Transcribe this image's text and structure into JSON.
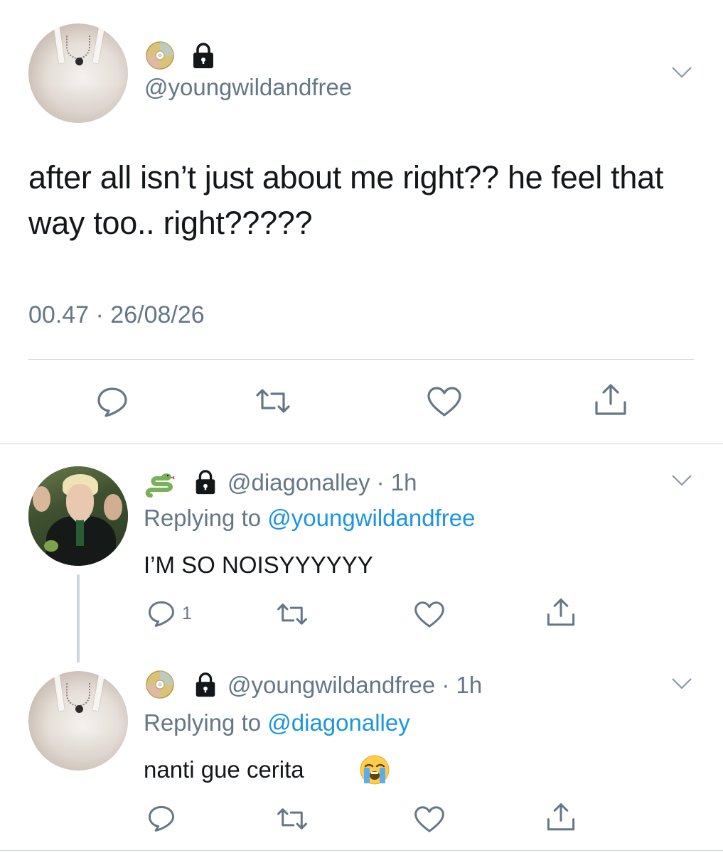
{
  "main_tweet": {
    "emoji_badge": "cd-icon",
    "lock_icon": "lock-icon",
    "handle": "@youngwildandfree",
    "text": "after all isn’t just about me right?? he feel that way too.. right?????",
    "timestamp": "00.47 · 26/08/26"
  },
  "replies": [
    {
      "emoji_badge": "snake-icon",
      "meta": "@diagonalley · 1h",
      "replying_prefix": "Replying to ",
      "replying_to": "@youngwildandfree",
      "text": "I’M SO NOISYYYYYY",
      "reply_count": "1"
    },
    {
      "emoji_badge": "cd-icon",
      "meta": "@youngwildandfree · 1h",
      "replying_prefix": "Replying to ",
      "replying_to": "@diagonalley",
      "text": "nanti gue cerita",
      "text_emoji": "😭"
    }
  ],
  "colors": {
    "text": "#14171a",
    "secondary": "#657786",
    "link": "#1b95e0",
    "divider": "#ccd6dd"
  }
}
